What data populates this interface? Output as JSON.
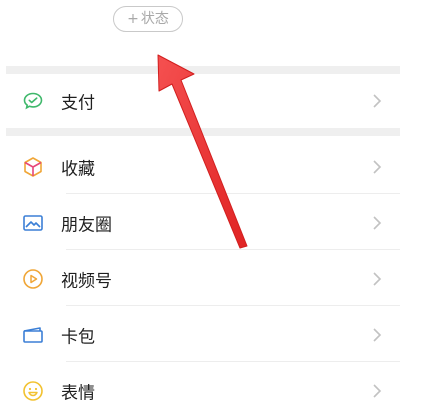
{
  "status": {
    "plus": "+",
    "label": "状态"
  },
  "menu": {
    "pay": "支付",
    "favorites": "收藏",
    "moments": "朋友圈",
    "channels": "视频号",
    "cards": "卡包",
    "stickers": "表情"
  },
  "colors": {
    "green": "#3fb86b",
    "orange": "#f0a637",
    "blue": "#3b7fd6",
    "yellow": "#f2c230",
    "arrow": "#f23c3c"
  }
}
